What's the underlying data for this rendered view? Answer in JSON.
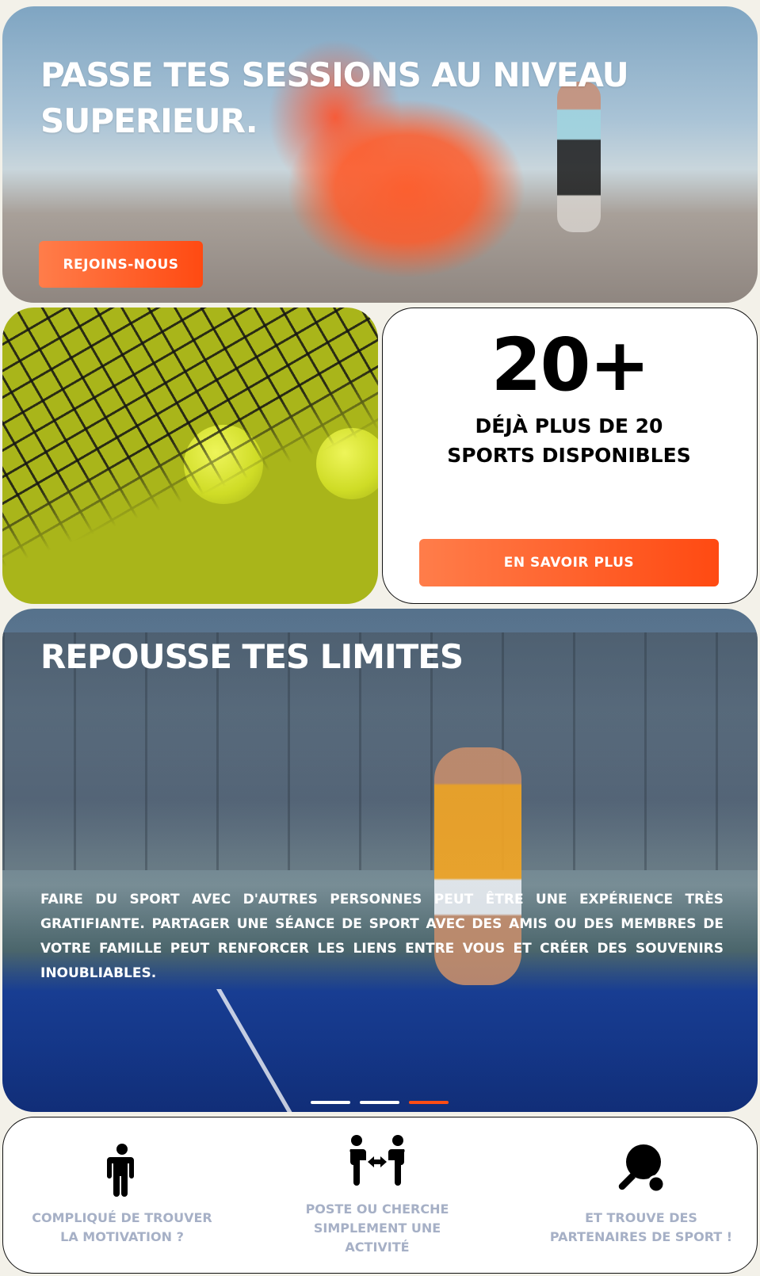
{
  "hero": {
    "title": "PASSE TES SESSIONS AU NIVEAU SUPERIEUR.",
    "button_label": "REJOINS-NOUS"
  },
  "stats": {
    "number": "20+",
    "text": "DÉJÀ PLUS DE 20 SPORTS DISPONIBLES",
    "button_label": "EN SAVOIR PLUS"
  },
  "carousel": {
    "title": "REPOUSSE TES LIMITES",
    "text": "FAIRE DU SPORT AVEC D'AUTRES PERSONNES PEUT ÊTRE UNE EXPÉRIENCE TRÈS GRATIFIANTE. PARTAGER UNE SÉANCE DE SPORT AVEC DES AMIS OU DES MEMBRES DE VOTRE FAMILLE PEUT RENFORCER LES LIENS ENTRE VOUS ET CRÉER DES SOUVENIRS INOUBLIABLES.",
    "slide_count": 3,
    "active_slide": 3
  },
  "features": [
    {
      "icon": "person-icon",
      "label": "COMPLIQUÉ DE TROUVER LA MOTIVATION ?"
    },
    {
      "icon": "people-exchange-icon",
      "label": "POSTE OU CHERCHE SIMPLEMENT UNE ACTIVITÉ"
    },
    {
      "icon": "ping-pong-icon",
      "label": "ET TROUVE DES PARTENAIRES DE SPORT !"
    }
  ],
  "colors": {
    "accent": "#ff4d14",
    "accent_light": "#ff7d4a",
    "feature_text": "#a6b0c6",
    "page_bg": "#f3f1e9"
  }
}
